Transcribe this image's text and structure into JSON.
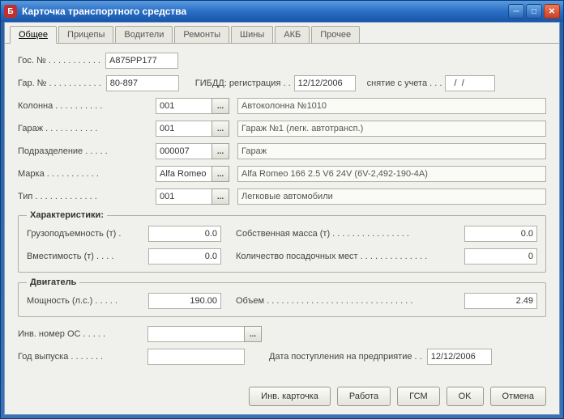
{
  "window": {
    "title": "Карточка транспортного средства",
    "icon": "Б"
  },
  "tabs": [
    "Общее",
    "Прицепы",
    "Водители",
    "Ремонты",
    "Шины",
    "АКБ",
    "Прочее"
  ],
  "labels": {
    "gos_no": "Гос. № . . . . . . . . . . .",
    "gar_no": "Гар. № . . . . . . . . . . .",
    "gibdd_reg": "ГИБДД: регистрация . .",
    "deregister": "снятие с учета . . .",
    "kolonna": "Колонна . . . . . . . . . .",
    "garage": "Гараж . . . . . . . . . . .",
    "subdivision": "Подразделение . . . . .",
    "brand": "Марка . . . . . . . . . . .",
    "type": "Тип . . . . . . . . . . . . .",
    "chars": "Характеристики:",
    "load": "Грузоподъемность (т) .",
    "own_mass": "Собственная масса (т) . . . . . . . . . . . . . . . .",
    "capacity": "Вместимость (т) . . . .",
    "seats": "Количество посадочных мест . . . . . . . . . . . . . .",
    "engine": "Двигатель",
    "power": "Мощность (л.с.) . . . . .",
    "volume": "Объем . . . . . . . . . . . . . . . . . . . . . . . . . . . . . .",
    "inv_os": "Инв. номер ОС . . . . .",
    "year": "Год выпуска . . . . . . .",
    "enroll_date": "Дата поступления на предприятие . ."
  },
  "values": {
    "gos_no": "А875РР177",
    "gar_no": "80-897",
    "reg_date": "12/12/2006",
    "dereg_date": "  /  /",
    "kolonna_code": "001",
    "kolonna_name": "Автоколонна №1010",
    "garage_code": "001",
    "garage_name": "Гараж №1 (легк. автотрансп.)",
    "subdiv_code": "000007",
    "subdiv_name": "Гараж",
    "brand_code": "Alfa Romeo",
    "brand_name": "Alfa Romeo 166 2.5 V6 24V (6V-2,492-190-4А)",
    "type_code": "001",
    "type_name": "Легковые автомобили",
    "load": "0.0",
    "own_mass": "0.0",
    "capacity": "0.0",
    "seats": "0",
    "power": "190.00",
    "volume": "2.49",
    "inv_os": "",
    "year": "",
    "enroll_date": "12/12/2006"
  },
  "buttons": {
    "inv_card": "Инв. карточка",
    "work": "Работа",
    "fuel": "ГСМ",
    "ok": "OK",
    "cancel": "Отмена"
  }
}
